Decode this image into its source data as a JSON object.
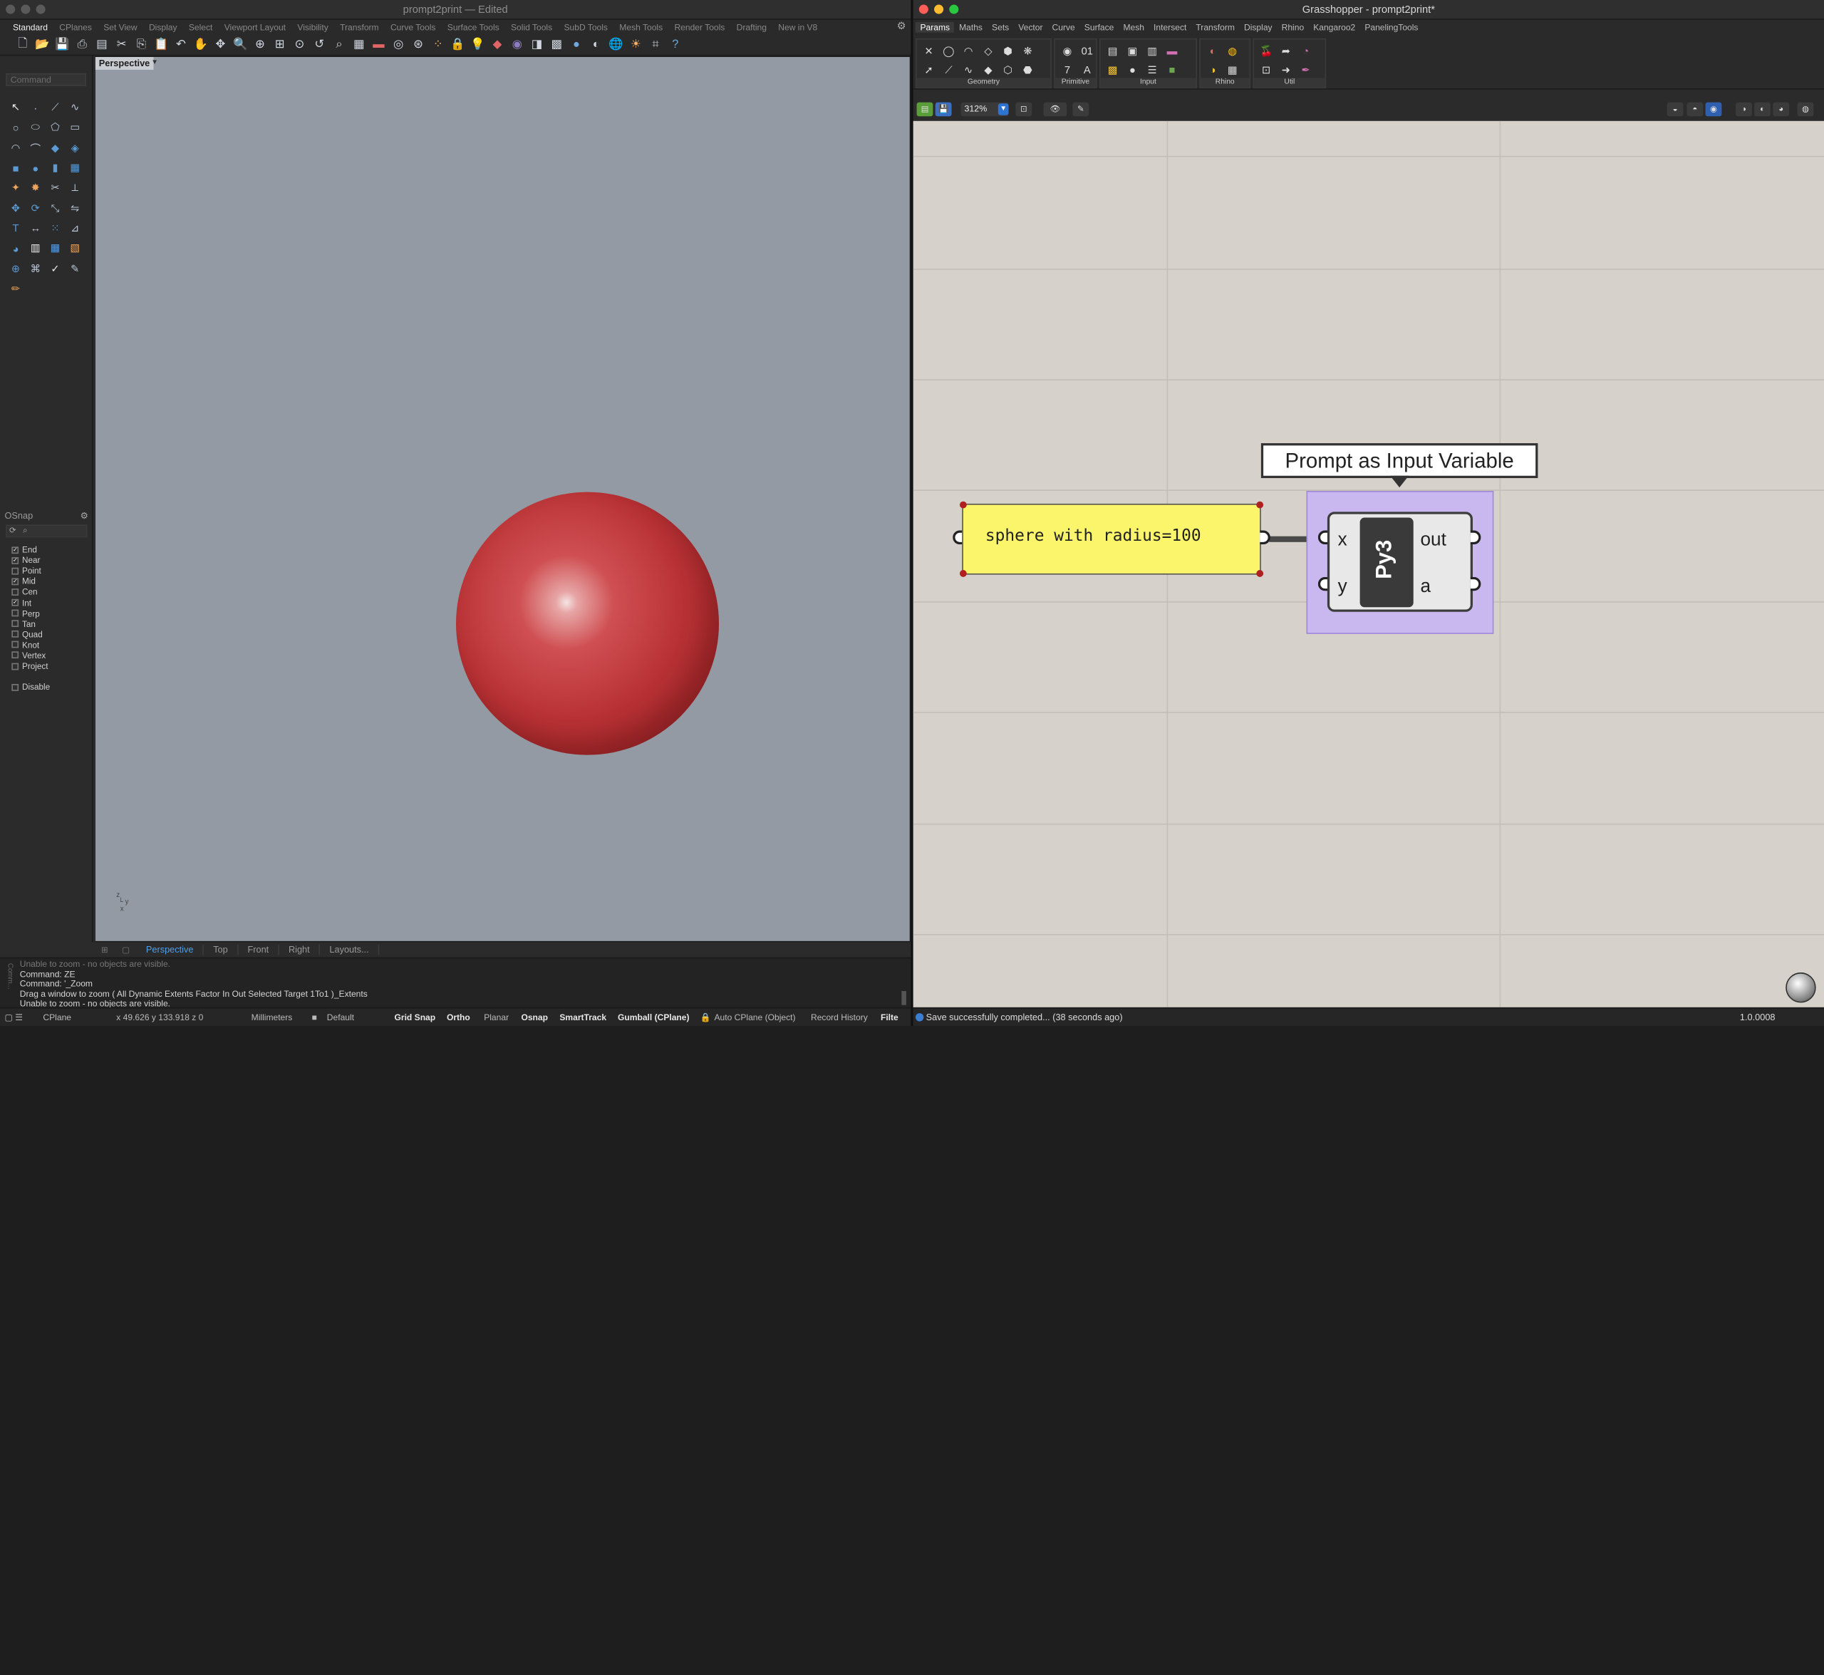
{
  "rhino": {
    "title": "prompt2print",
    "title_suffix": " — Edited",
    "tabs": [
      "Standard",
      "CPlanes",
      "Set View",
      "Display",
      "Select",
      "Viewport Layout",
      "Visibility",
      "Transform",
      "Curve Tools",
      "Surface Tools",
      "Solid Tools",
      "SubD Tools",
      "Mesh Tools",
      "Render Tools",
      "Drafting",
      "New in V8"
    ],
    "command_placeholder": "Command",
    "viewport_name": "Perspective",
    "viewport_tabs": [
      "Perspective",
      "Top",
      "Front",
      "Right",
      "Layouts..."
    ],
    "osnap_title": "OSnap",
    "osnap_items": [
      {
        "label": "End",
        "checked": true
      },
      {
        "label": "Near",
        "checked": true
      },
      {
        "label": "Point",
        "checked": false
      },
      {
        "label": "Mid",
        "checked": true
      },
      {
        "label": "Cen",
        "checked": false
      },
      {
        "label": "Int",
        "checked": true
      },
      {
        "label": "Perp",
        "checked": false
      },
      {
        "label": "Tan",
        "checked": false
      },
      {
        "label": "Quad",
        "checked": false
      },
      {
        "label": "Knot",
        "checked": false
      },
      {
        "label": "Vertex",
        "checked": false
      },
      {
        "label": "Project",
        "checked": false
      }
    ],
    "osnap_disable": "Disable",
    "history_side": "Comm...",
    "history": [
      "Unable to zoom - no objects are visible.",
      "Command: ZE",
      "Command: '_Zoom",
      "Drag a window to zoom ( All Dynamic Extents Factor In Out Selected Target 1To1 )_Extents",
      "Unable to zoom - no objects are visible."
    ],
    "status": {
      "cplane": "CPlane",
      "coords": "x 49.626   y 133.918   z 0",
      "units": "Millimeters",
      "layer": "Default",
      "grid_snap": "Grid Snap",
      "ortho": "Ortho",
      "planar": "Planar",
      "osnap": "Osnap",
      "smarttrack": "SmartTrack",
      "gumball": "Gumball (CPlane)",
      "auto_cplane": "Auto CPlane (Object)",
      "record_history": "Record History",
      "filter": "Filte"
    }
  },
  "grasshopper": {
    "title": "Grasshopper - prompt2print*",
    "menu": [
      "Params",
      "Maths",
      "Sets",
      "Vector",
      "Curve",
      "Surface",
      "Mesh",
      "Intersect",
      "Transform",
      "Display",
      "Rhino",
      "Kangaroo2",
      "PanelingTools"
    ],
    "ribbon_groups": [
      "Geometry",
      "Primitive",
      "Input",
      "Rhino",
      "Util"
    ],
    "zoom": "312%",
    "panel_text": "sphere with radius=100",
    "component_name": "Py3",
    "inputs": [
      "x",
      "y"
    ],
    "outputs": [
      "out",
      "a"
    ],
    "bubble": "Prompt as Input Variable",
    "status_message": "Save successfully completed... (38 seconds ago)",
    "version": "1.0.0008"
  }
}
